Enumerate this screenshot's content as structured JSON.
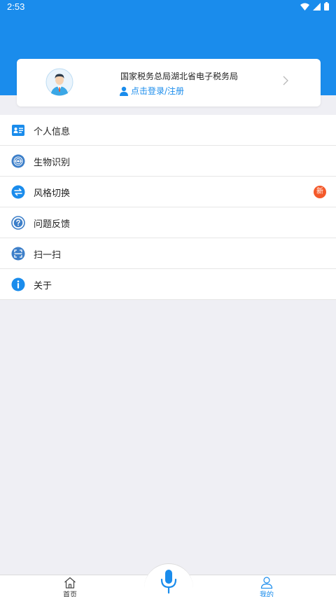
{
  "status_bar": {
    "time": "2:53"
  },
  "profile": {
    "org_name": "国家税务总局湖北省电子税务局",
    "login_text": "点击登录/注册"
  },
  "menu": [
    {
      "label": "个人信息",
      "icon": "id-card-icon"
    },
    {
      "label": "生物识别",
      "icon": "fingerprint-icon"
    },
    {
      "label": "风格切换",
      "icon": "switch-arrows-icon",
      "badge": "新"
    },
    {
      "label": "问题反馈",
      "icon": "question-icon"
    },
    {
      "label": "扫一扫",
      "icon": "scan-icon"
    },
    {
      "label": "关于",
      "icon": "info-icon"
    }
  ],
  "tabbar": {
    "home_label": "首页",
    "mine_label": "我的"
  },
  "colors": {
    "primary": "#1a8cec",
    "badge": "#f4592a",
    "background": "#efeff4"
  }
}
